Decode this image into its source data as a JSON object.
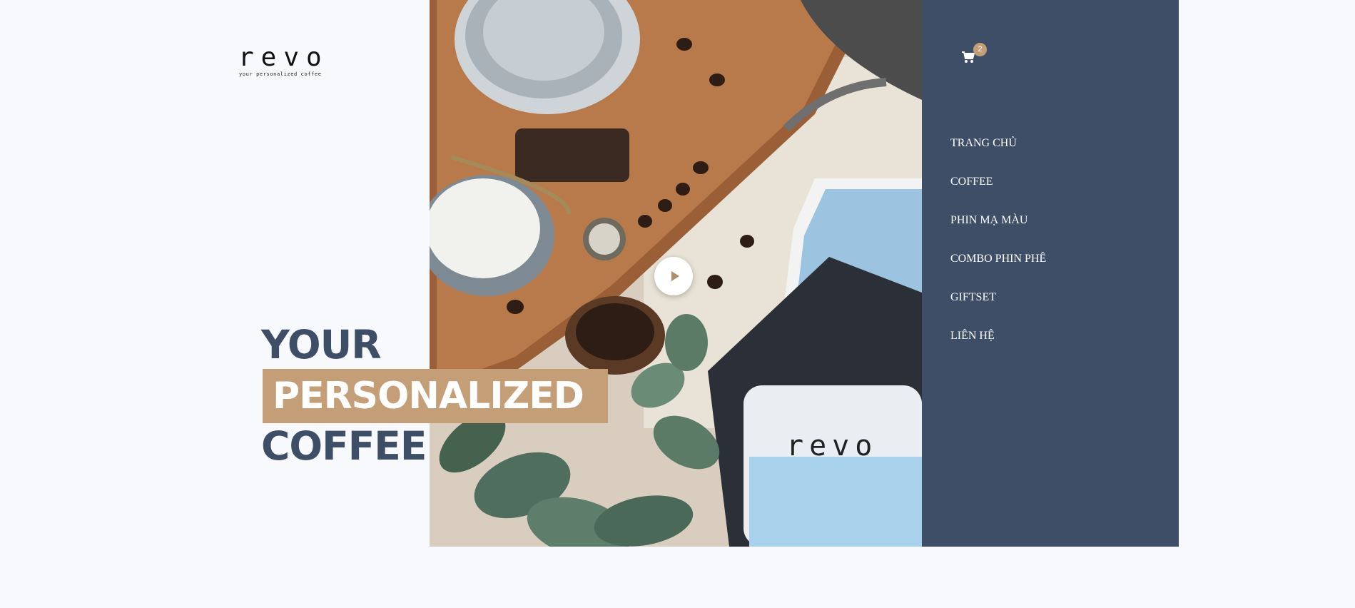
{
  "brand": {
    "logo_text": "revo",
    "tagline": "your personalized coffee"
  },
  "hero": {
    "headline_line1": "YOUR",
    "headline_line2": "PERSONALIZED",
    "headline_line3": "COFFEE",
    "play_icon": "play-icon",
    "photo_description_icon": "hero-photo"
  },
  "cart": {
    "icon": "cart-icon",
    "count": "2"
  },
  "nav": {
    "items": [
      {
        "label": "TRANG CHỦ"
      },
      {
        "label": "COFFEE"
      },
      {
        "label": "PHIN MẠ MÀU"
      },
      {
        "label": "COMBO PHIN PHÊ"
      },
      {
        "label": "GIFTSET"
      },
      {
        "label": "LIÊN HỆ"
      }
    ]
  },
  "colors": {
    "navy": "#3e4e66",
    "tan": "#c49e76",
    "background": "#f8f9fc"
  }
}
